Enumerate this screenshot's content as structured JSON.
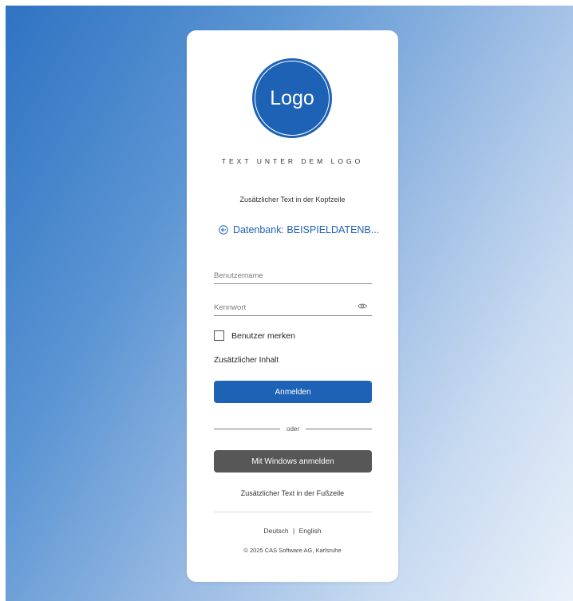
{
  "logo": {
    "text": "Logo",
    "color": "#1d62b5"
  },
  "header": {
    "under_logo": "TEXT UNTER DEM LOGO",
    "extra_text": "Zusätzlicher Text in der Kopfzeile"
  },
  "database": {
    "icon": "arrow-left-circle-icon",
    "label": "Datenbank: BEISPIELDATENB..."
  },
  "form": {
    "username_placeholder": "Benutzername",
    "username_value": "",
    "password_placeholder": "Kennwort",
    "password_value": "",
    "password_icon": "eye-icon",
    "remember_label": "Benutzer merken",
    "remember_checked": false,
    "extra_content": "Zusätzlicher Inhalt",
    "login_label": "Anmelden",
    "or_label": "oder",
    "windows_label": "Mit Windows anmelden"
  },
  "footer": {
    "extra_text": "Zusätzlicher Text in der Fußzeile",
    "languages": [
      "Deutsch",
      "English"
    ],
    "separator": "|",
    "copyright": "© 2025 CAS Software AG, Karlsruhe"
  },
  "colors": {
    "accent": "#1d62b5",
    "windows_button": "#575757",
    "background_start": "#2f73c2",
    "background_end": "#eaf1fa"
  }
}
